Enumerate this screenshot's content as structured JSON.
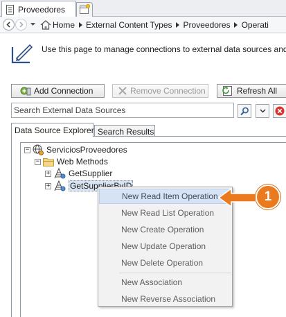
{
  "tab": {
    "title": "Proveedores"
  },
  "breadcrumb": [
    "Home",
    "External Content Types",
    "Proveedores",
    "Operati"
  ],
  "info": {
    "text": "Use this page to manage connections to external data sources and t"
  },
  "toolbar": {
    "add_label": "Add Connection",
    "remove_label": "Remove Connection",
    "refresh_label": "Refresh All"
  },
  "search": {
    "placeholder": "Search External Data Sources"
  },
  "panel_tabs": [
    "Data Source Explorer",
    "Search Results"
  ],
  "tree": {
    "root": "ServiciosProveedores",
    "folder": "Web Methods",
    "methods": [
      "GetSupplier",
      "GetSupplierByID"
    ]
  },
  "context_menu": {
    "group1": [
      "New Read Item Operation",
      "New Read List Operation",
      "New Create Operation",
      "New Update Operation",
      "New Delete Operation"
    ],
    "group2": [
      "New Association",
      "New Reverse Association"
    ]
  },
  "callout": {
    "number": "1"
  },
  "colors": {
    "accent_orange": "#eb7a1f",
    "menu_highlight": "#d5e3f5",
    "selected_node": "#d9e4f2"
  },
  "icons": [
    "document-icon",
    "new-tab-icon",
    "back-icon",
    "forward-icon",
    "home-icon",
    "info-pencil-icon",
    "add-connection-icon",
    "remove-icon",
    "refresh-icon",
    "search-icon",
    "chevron-down-icon",
    "clear-icon",
    "globe-icon",
    "folder-icon",
    "web-method-icon"
  ]
}
